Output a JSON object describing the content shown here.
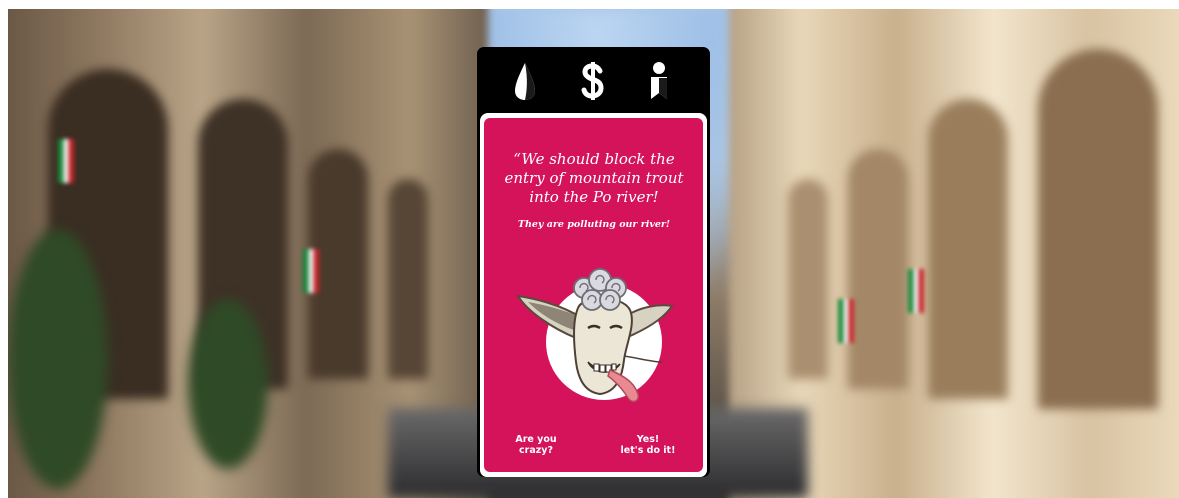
{
  "stats": [
    {
      "icon": "drop-icon",
      "label": "environment"
    },
    {
      "icon": "dollar-icon",
      "label": "money"
    },
    {
      "icon": "person-icon",
      "label": "people"
    }
  ],
  "card": {
    "quote": "“We should block the entry of mountain trout into the Po river!",
    "subquote": "They are polluting our river!",
    "character_icon": "goat-character-icon"
  },
  "choices": {
    "left_line1": "Are you",
    "left_line2": "crazy?",
    "right_line1": "Yes!",
    "right_line2": "let's do it!"
  },
  "colors": {
    "card_background": "#d4135a",
    "top_bar": "#000000",
    "text": "#ffffff"
  }
}
